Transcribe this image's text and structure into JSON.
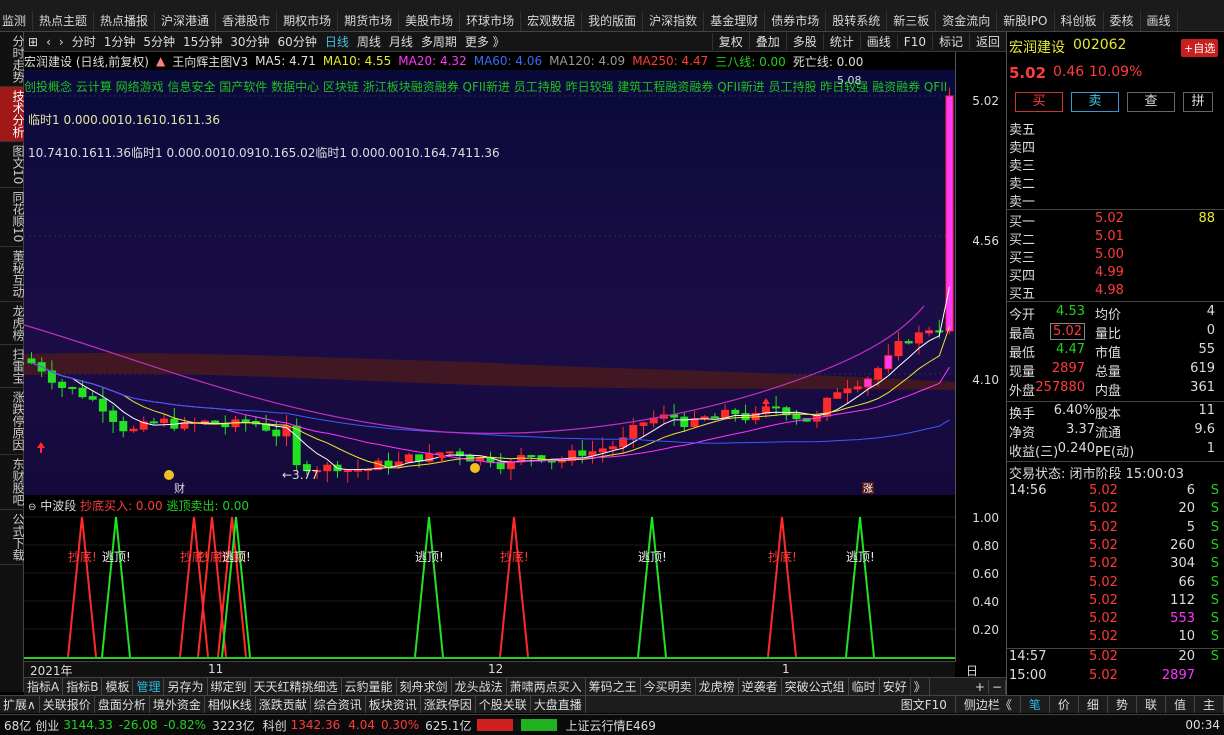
{
  "top_menu": [
    "监测",
    "热点主题",
    "热点播报",
    "沪深港通",
    "香港股市",
    "期权市场",
    "期货市场",
    "美股市场",
    "环球市场",
    "宏观数据",
    "我的版面",
    "沪深指数",
    "基金理财",
    "债券市场",
    "股转系统",
    "新三板",
    "资金流向",
    "新股IPO",
    "科创板",
    "委核",
    "画线"
  ],
  "left_rail": [
    {
      "label": "分时走势",
      "active": false
    },
    {
      "label": "技术分析",
      "active": true
    },
    {
      "label": "图文10",
      "active": false
    },
    {
      "label": "同花顺10",
      "active": false
    },
    {
      "label": "董秘互动",
      "active": false
    },
    {
      "label": "龙虎榜",
      "active": false
    },
    {
      "label": "扫雷宝",
      "active": false
    },
    {
      "label": "涨跌停原因",
      "active": false
    },
    {
      "label": "东财股吧",
      "active": false
    },
    {
      "label": "公式下载",
      "active": false
    }
  ],
  "period_bar": {
    "periods": [
      "分时",
      "1分钟",
      "5分钟",
      "15分钟",
      "30分钟",
      "60分钟",
      "日线",
      "周线",
      "月线",
      "多周期",
      "更多 》"
    ],
    "selected": "日线",
    "right_tools": [
      "复权",
      "叠加",
      "多股",
      "统计",
      "画线",
      "F10",
      "标记",
      "返回"
    ]
  },
  "legend": {
    "title": "宏润建设 (日线,前复权)",
    "formula": "王向辉主图V3",
    "ma5": "MA5: 4.71",
    "ma10": "MA10: 4.55",
    "ma20": "MA20: 4.32",
    "ma60": "MA60: 4.06",
    "ma120": "MA120: 4.09",
    "ma250": "MA250: 4.47",
    "sanba": "三八线: 0.00",
    "death": "死亡线: 0.00"
  },
  "concepts": "创投概念 云计算 网络游戏 信息安全 国产软件 数据中心 区块链 浙江板块融资融券 QFII新进 员工持股 昨日较强 建筑工程融资融券 QFII新进 员工持股 昨日较强 融资融券 QFII",
  "temp_line1": "临时1 0.000.0010.1610.1611.36",
  "temp_line2": "10.7410.1611.36临时1 0.000.0010.0910.165.02临时1 0.000.0010.164.7411.36",
  "main_annotations": {
    "low_price": "←3.77",
    "high_price": "5.08",
    "cai_label": "财",
    "zhang_label": "涨"
  },
  "y_axis_main": [
    "5.02",
    "4.56",
    "4.10"
  ],
  "sub_indicator": {
    "name": "中波段",
    "buy": "抄底买入: 0.00",
    "sell": "逃顶卖出: 0.00",
    "buy_tag": "抄底!",
    "sell_tag": "逃顶!"
  },
  "y_axis_sub": [
    "1.00",
    "0.80",
    "0.60",
    "0.40",
    "0.20"
  ],
  "x_axis": {
    "year": "2021年",
    "m11": "11",
    "m12": "12",
    "m1": "1",
    "period": "日线"
  },
  "bottom_tabs": [
    "指标A",
    "指标B",
    "模板",
    "管理",
    "另存为",
    "绑定到",
    "天天红精挑细选",
    "云豹量能",
    "刻舟求剑",
    "龙头战法",
    "萧啸两点买入",
    "筹码之王",
    "今买明卖",
    "龙虎榜",
    "逆袭者",
    "突破公式组",
    "临时",
    "安好",
    "》"
  ],
  "bottom_tab_selected": "管理",
  "ext_tabs": [
    "扩展∧",
    "关联报价",
    "盘面分析",
    "境外资金",
    "相似K线",
    "涨跌贡献",
    "综合资讯",
    "板块资讯",
    "涨跌停因",
    "个股关联",
    "大盘直播"
  ],
  "ext_right": [
    "图文F10",
    "侧边栏《",
    "笔",
    "价",
    "细",
    "势",
    "联",
    "值",
    "主"
  ],
  "status_bar": {
    "sh": "68亿",
    "cy_label": "创业",
    "cy_index": "3144.33",
    "cy_chg": "-26.08",
    "cy_pct": "-0.82%",
    "cy_amt": "3223亿",
    "kc_label": "科创",
    "kc_index": "1342.36",
    "kc_chg": "4.04",
    "kc_pct": "0.30%",
    "kc_amt": "625.1亿",
    "ticker": "上证云行情E469",
    "time": "00:34"
  },
  "quote": {
    "name": "宏润建设",
    "code": "002062",
    "add_watch": "+自选",
    "price": "5.02",
    "change": "0.46",
    "pct": "10.09%",
    "buttons": [
      "买",
      "卖",
      "查",
      "拼"
    ],
    "asks": [
      {
        "label": "卖五",
        "price": "",
        "vol": ""
      },
      {
        "label": "卖四",
        "price": "",
        "vol": ""
      },
      {
        "label": "卖三",
        "price": "",
        "vol": ""
      },
      {
        "label": "卖二",
        "price": "",
        "vol": ""
      },
      {
        "label": "卖一",
        "price": "",
        "vol": ""
      }
    ],
    "bids": [
      {
        "label": "买一",
        "price": "5.02",
        "vol": "88"
      },
      {
        "label": "买二",
        "price": "5.01",
        "vol": ""
      },
      {
        "label": "买三",
        "price": "5.00",
        "vol": ""
      },
      {
        "label": "买四",
        "price": "4.99",
        "vol": ""
      },
      {
        "label": "买五",
        "price": "4.98",
        "vol": ""
      }
    ],
    "stats": [
      {
        "l1": "今开",
        "v1": "4.53",
        "c1": "green",
        "l2": "均价",
        "v2": "4"
      },
      {
        "l1": "最高",
        "v1": "5.02",
        "c1": "red",
        "l2": "量比",
        "v2": "0"
      },
      {
        "l1": "最低",
        "v1": "4.47",
        "c1": "green",
        "l2": "市值",
        "v2": "55"
      },
      {
        "l1": "现量",
        "v1": "2897",
        "c1": "red",
        "l2": "总量",
        "v2": "619"
      },
      {
        "l1": "外盘",
        "v1": "257880",
        "c1": "red",
        "l2": "内盘",
        "v2": "361"
      }
    ],
    "stats2": [
      {
        "l1": "换手",
        "v1": "6.40%",
        "l2": "股本",
        "v2": "11"
      },
      {
        "l1": "净资",
        "v1": "3.37",
        "l2": "流通",
        "v2": "9.6"
      },
      {
        "l1": "收益(三)",
        "v1": "0.240",
        "l2": "PE(动)",
        "v2": "1"
      }
    ],
    "trade_status": "交易状态: 闭市阶段 15:00:03",
    "ticks": [
      {
        "time": "14:56",
        "price": "5.02",
        "vol": "6",
        "side": "S",
        "vc": "white"
      },
      {
        "time": "",
        "price": "5.02",
        "vol": "20",
        "side": "S",
        "vc": "white"
      },
      {
        "time": "",
        "price": "5.02",
        "vol": "5",
        "side": "S",
        "vc": "white"
      },
      {
        "time": "",
        "price": "5.02",
        "vol": "260",
        "side": "S",
        "vc": "white"
      },
      {
        "time": "",
        "price": "5.02",
        "vol": "304",
        "side": "S",
        "vc": "white"
      },
      {
        "time": "",
        "price": "5.02",
        "vol": "66",
        "side": "S",
        "vc": "white"
      },
      {
        "time": "",
        "price": "5.02",
        "vol": "112",
        "side": "S",
        "vc": "white"
      },
      {
        "time": "",
        "price": "5.02",
        "vol": "553",
        "side": "S",
        "vc": "mag"
      },
      {
        "time": "",
        "price": "5.02",
        "vol": "10",
        "side": "S",
        "vc": "white"
      },
      {
        "time": "14:57",
        "price": "5.02",
        "vol": "20",
        "side": "S",
        "vc": "white"
      },
      {
        "time": "15:00",
        "price": "5.02",
        "vol": "2897",
        "side": "",
        "vc": "mag"
      }
    ]
  },
  "colors": {
    "up": "#ff3b3b",
    "down": "#22d022",
    "accent": "#2ab8e0",
    "ma5": "#ffffff",
    "ma10": "#e8e830",
    "ma20": "#ff35ff",
    "ma60": "#3a5aff",
    "ma120": "#999999",
    "ma250": "#ff3b3b"
  }
}
